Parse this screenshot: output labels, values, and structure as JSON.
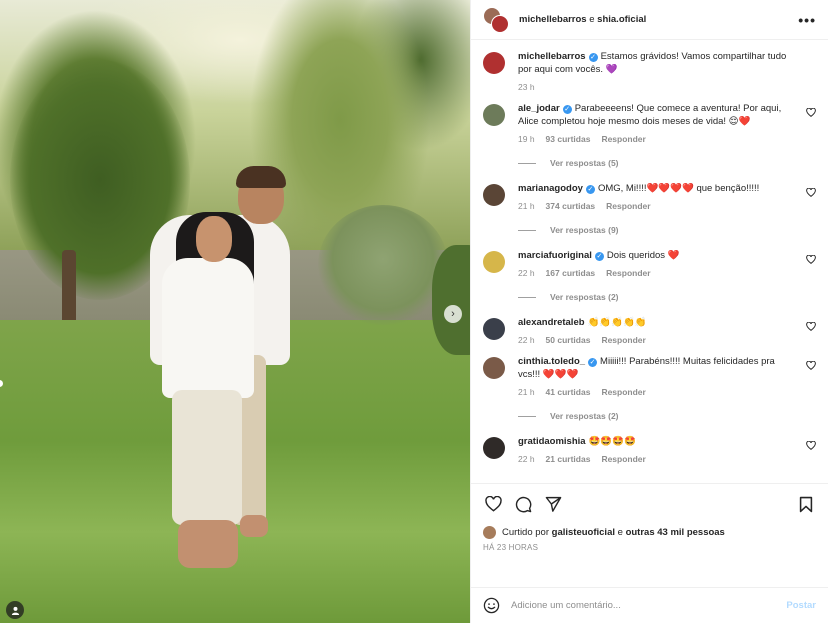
{
  "header": {
    "user1": "michellebarros",
    "conj": "e",
    "user2": "shia.oficial",
    "more_icon": "more-horizontal-icon"
  },
  "caption": {
    "user": "michellebarros",
    "text": "Estamos grávidos! Vamos compartilhar tudo por aqui com vocês. 💜",
    "time": "23 h"
  },
  "comments": [
    {
      "user": "ale_jodar",
      "verified": true,
      "text": "Parabeeeens! Que comece a aventura! Por aqui, Alice completou hoje mesmo dois meses de vida! 😌❤️",
      "time": "19 h",
      "likes": "93 curtidas",
      "reply": "Responder",
      "replies": "Ver respostas (5)",
      "avatar_color": "#6d7b5a"
    },
    {
      "user": "marianagodoy",
      "verified": true,
      "text": "OMG, Mi!!!!❤️❤️❤️❤️ que benção!!!!!",
      "time": "21 h",
      "likes": "374 curtidas",
      "reply": "Responder",
      "replies": "Ver respostas (9)",
      "avatar_color": "#5a4536"
    },
    {
      "user": "marciafuoriginal",
      "verified": true,
      "text": "Dois queridos ❤️",
      "time": "22 h",
      "likes": "167 curtidas",
      "reply": "Responder",
      "replies": "Ver respostas (2)",
      "avatar_color": "#d6b64a"
    },
    {
      "user": "alexandretaleb",
      "verified": false,
      "text": "👏👏👏👏👏",
      "time": "22 h",
      "likes": "50 curtidas",
      "reply": "Responder",
      "replies": "",
      "avatar_color": "#3a3f4a"
    },
    {
      "user": "cinthia.toledo_",
      "verified": true,
      "text": "Miiiii!!! Parabéns!!!! Muitas felicidades pra vcs!!! ❤️❤️❤️",
      "time": "21 h",
      "likes": "41 curtidas",
      "reply": "Responder",
      "replies": "Ver respostas (2)",
      "avatar_color": "#7a5a48"
    },
    {
      "user": "gratidaomishia",
      "verified": false,
      "text": "🤩🤩🤩🤩",
      "time": "22 h",
      "likes": "21 curtidas",
      "reply": "Responder",
      "replies": "",
      "avatar_color": "#2f2a28"
    }
  ],
  "actions": {
    "like_icon": "heart-icon",
    "comment_icon": "comment-icon",
    "share_icon": "send-icon",
    "save_icon": "bookmark-icon"
  },
  "liked_by": {
    "prefix": "Curtido por",
    "user": "galisteuoficial",
    "mid": "e",
    "others": "outras 43 mil pessoas"
  },
  "post_time": "HÁ 23 HORAS",
  "add_comment": {
    "placeholder": "Adicione um comentário...",
    "post_label": "Postar"
  },
  "colors": {
    "verified": "#3897f0",
    "muted": "#8e8e8e",
    "post_disabled": "#b3dbff"
  }
}
